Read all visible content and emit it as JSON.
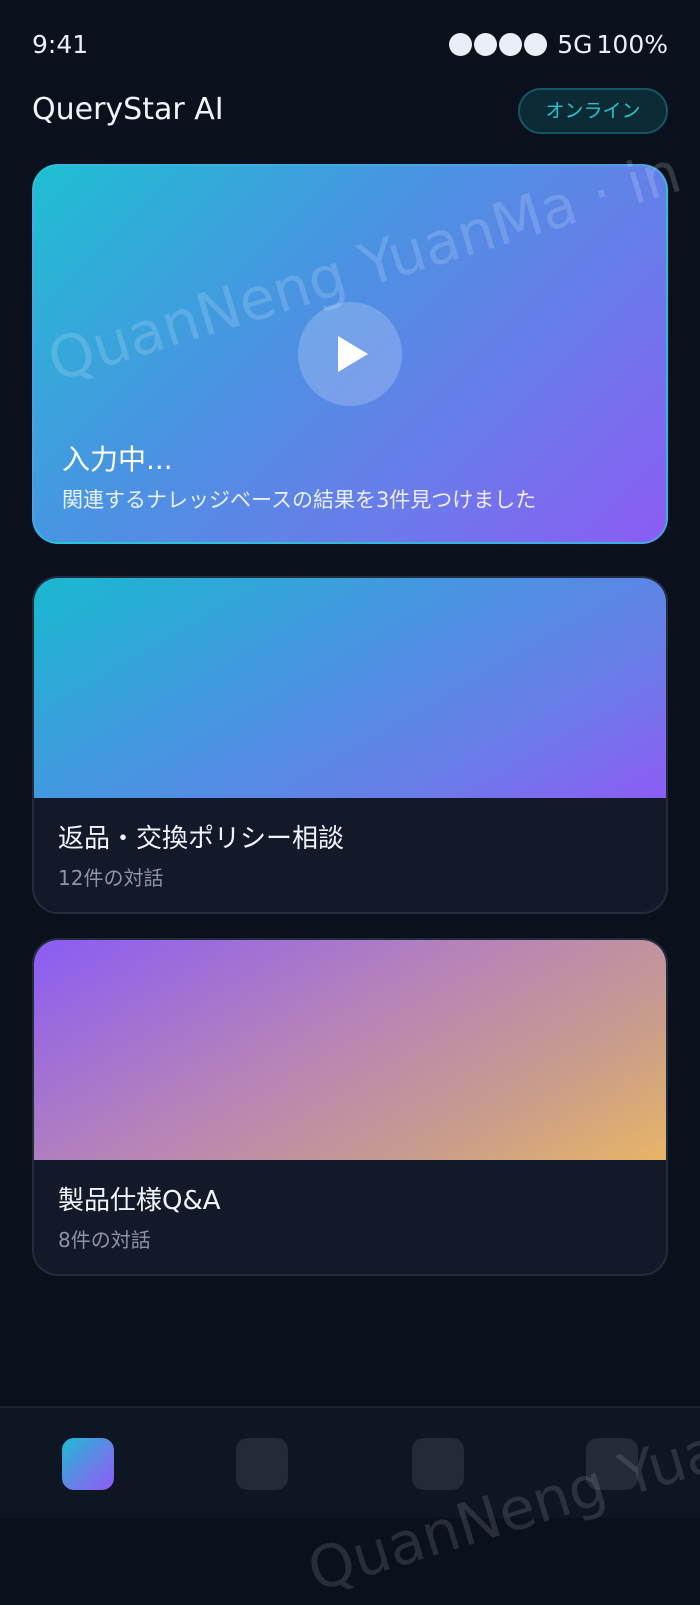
{
  "status_bar": {
    "time": "9:41",
    "network": "5G",
    "battery": "100%",
    "signal_bars": 4
  },
  "header": {
    "title": "QueryStar AI",
    "status_badge": "オンライン"
  },
  "hero": {
    "status": "入力中...",
    "subtitle": "関連するナレッジベースの結果を3件見つけました",
    "icon": "play-icon"
  },
  "conversations": [
    {
      "title": "返品・交換ポリシー相談",
      "count": "12件の対話"
    },
    {
      "title": "製品仕様Q&A",
      "count": "8件の対話"
    }
  ],
  "bottom_nav": {
    "items": [
      "home-icon",
      "tab-icon",
      "tab-icon",
      "tab-icon"
    ],
    "active_index": 0
  },
  "watermark": "QuanNeng YuanMa · in",
  "colors": {
    "background": "#0b111c",
    "accent": "#23c4d6",
    "purple": "#8c5cf4",
    "orange": "#e8b565"
  }
}
